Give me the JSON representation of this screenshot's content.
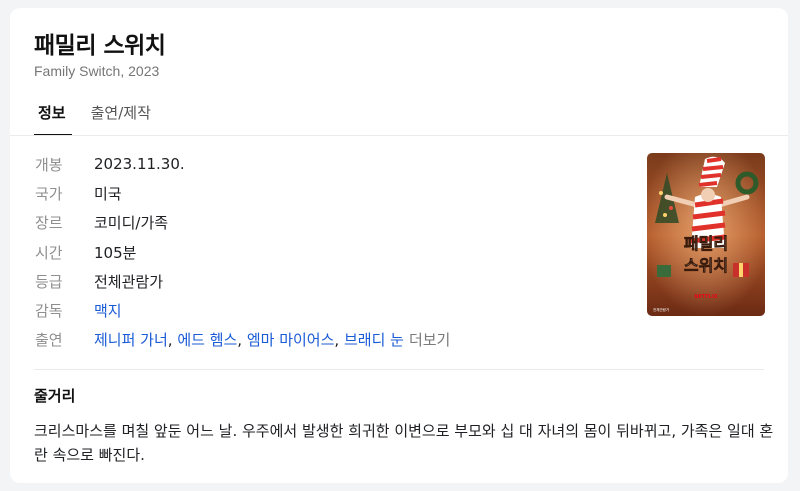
{
  "movie": {
    "title": "패밀리 스위치",
    "subtitle": "Family Switch, 2023"
  },
  "tabs": [
    {
      "label": "정보",
      "active": true
    },
    {
      "label": "출연/제작",
      "active": false
    }
  ],
  "info": {
    "release": {
      "label": "개봉",
      "value": "2023.11.30."
    },
    "country": {
      "label": "국가",
      "value": "미국"
    },
    "genre": {
      "label": "장르",
      "value": "코미디/가족"
    },
    "runtime": {
      "label": "시간",
      "value": "105분"
    },
    "rating": {
      "label": "등급",
      "value": "전체관람가"
    },
    "director": {
      "label": "감독",
      "value": "맥지"
    },
    "cast": {
      "label": "출연",
      "names": [
        "제니퍼 가너",
        "에드 헴스",
        "엠마 마이어스",
        "브래디 눈"
      ],
      "more_label": "더보기"
    }
  },
  "poster": {
    "text_line1": "패밀리",
    "text_line2": "스위치",
    "brand_text": "NETFLIX",
    "corner_text": "전체관람가"
  },
  "synopsis": {
    "title": "줄거리",
    "text": "크리스마스를 며칠 앞둔 어느 날. 우주에서 발생한 희귀한 이변으로 부모와 십 대 자녀의 몸이 뒤바뀌고, 가족은 일대 혼란 속으로 빠진다."
  },
  "colors": {
    "link": "#1a5bd6",
    "label": "#8f8f8f",
    "background": "#f3f4f6",
    "card": "#ffffff"
  }
}
